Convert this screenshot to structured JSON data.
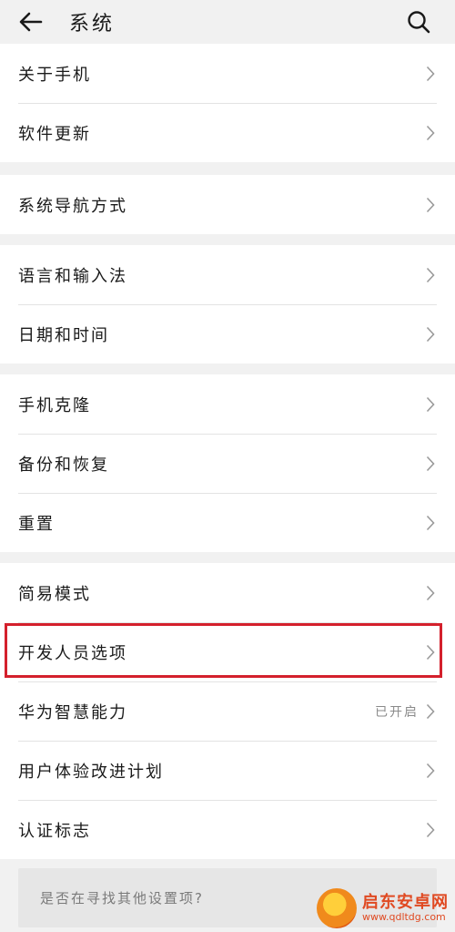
{
  "header": {
    "title": "系统",
    "back_icon": "back-arrow-icon",
    "search_icon": "search-icon"
  },
  "groups": [
    {
      "items": [
        {
          "label": "关于手机"
        },
        {
          "label": "软件更新"
        }
      ]
    },
    {
      "items": [
        {
          "label": "系统导航方式"
        }
      ]
    },
    {
      "items": [
        {
          "label": "语言和输入法"
        },
        {
          "label": "日期和时间"
        }
      ]
    },
    {
      "items": [
        {
          "label": "手机克隆"
        },
        {
          "label": "备份和恢复"
        },
        {
          "label": "重置"
        }
      ]
    },
    {
      "items": [
        {
          "label": "简易模式"
        },
        {
          "label": "开发人员选项",
          "highlighted": true
        },
        {
          "label": "华为智慧能力",
          "status": "已开启"
        },
        {
          "label": "用户体验改进计划"
        },
        {
          "label": "认证标志"
        }
      ]
    }
  ],
  "suggestion": {
    "text": "是否在寻找其他设置项?"
  },
  "watermark": {
    "name": "启东安卓网",
    "url": "www.qdltdg.com"
  },
  "colors": {
    "highlight_border": "#d4202c",
    "background": "#f1f1f1"
  }
}
